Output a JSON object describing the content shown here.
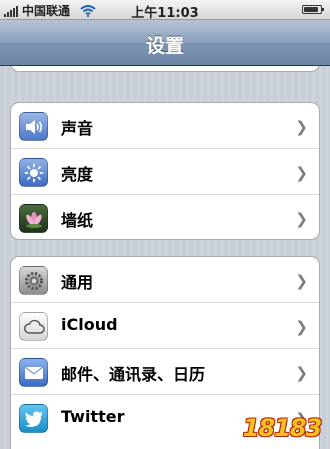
{
  "status_bar": {
    "carrier": "中国联通",
    "time": "上午11:03",
    "battery_level": 0.85
  },
  "nav": {
    "title": "设置"
  },
  "groups": [
    {
      "cells": [
        {
          "label": "声音",
          "icon": "speaker-icon"
        },
        {
          "label": "亮度",
          "icon": "brightness-icon"
        },
        {
          "label": "墙纸",
          "icon": "wallpaper-icon"
        }
      ]
    },
    {
      "cells": [
        {
          "label": "通用",
          "icon": "gear-icon"
        },
        {
          "label": "iCloud",
          "icon": "cloud-icon"
        },
        {
          "label": "邮件、通讯录、日历",
          "icon": "envelope-icon"
        },
        {
          "label": "Twitter",
          "icon": "twitter-bird-icon"
        }
      ]
    }
  ],
  "watermark": {
    "text": "18183"
  },
  "colors": {
    "nav_gradient_top": "#b5c3d6",
    "nav_gradient_bottom": "#6d85a5",
    "background": "#c5ccd4",
    "chevron": "#7f7f7f",
    "watermark": "#f7c21b"
  }
}
